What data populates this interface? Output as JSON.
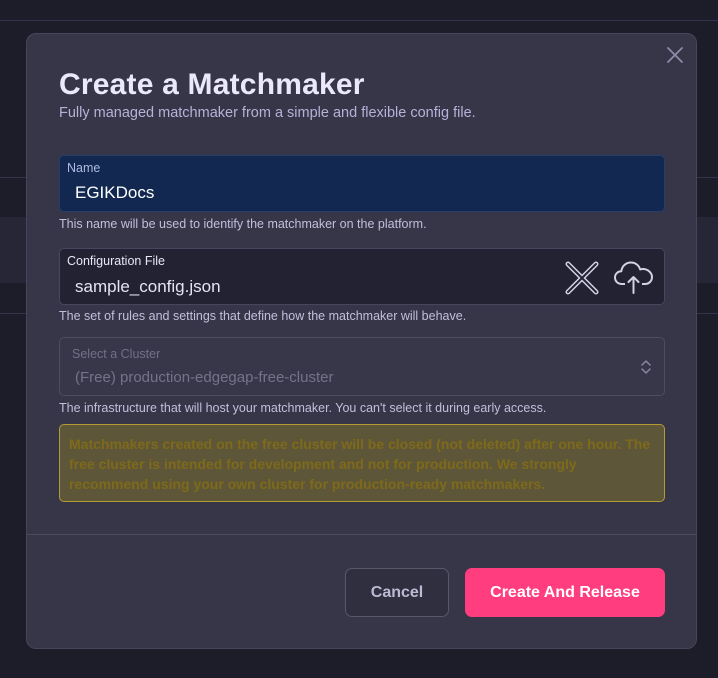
{
  "modal": {
    "title": "Create a Matchmaker",
    "subtitle": "Fully managed matchmaker from a simple and flexible config file.",
    "close_icon": "close-icon"
  },
  "name_field": {
    "label": "Name",
    "value": "EGIKDocs",
    "helper": "This name will be used to identify the matchmaker on the platform."
  },
  "config_field": {
    "label": "Configuration File",
    "value": "sample_config.json",
    "helper": "The set of rules and settings that define how the matchmaker will behave.",
    "clear_icon": "x-icon",
    "upload_icon": "cloud-upload-icon"
  },
  "cluster_field": {
    "label": "Select a Cluster",
    "value": "(Free) production-edgegap-free-cluster",
    "helper": "The infrastructure that will host your matchmaker. You can't select it during early access.",
    "disabled": true
  },
  "warning": {
    "text": "Matchmakers created on the free cluster will be closed (not deleted) after one hour. The free cluster is intended for development and not for production. We strongly recommend using your own cluster for production-ready matchmakers."
  },
  "footer": {
    "cancel_label": "Cancel",
    "create_label": "Create And Release"
  },
  "colors": {
    "primary": "#ff3d7f",
    "name_field_bg": "#122850",
    "warning_bg": "#5e5638",
    "warning_border": "#b59b33"
  }
}
